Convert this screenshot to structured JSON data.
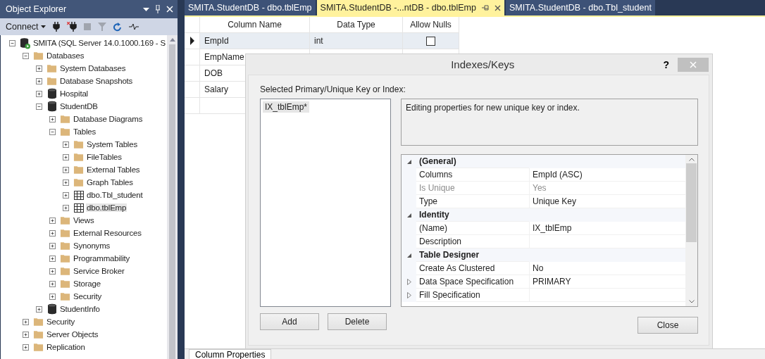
{
  "explorer": {
    "title": "Object Explorer",
    "connect": "Connect",
    "tree": [
      {
        "label": "SMITA (SQL Server 14.0.1000.169 - S",
        "kind": "server",
        "expanded": true,
        "selected": false,
        "children": [
          {
            "label": "Databases",
            "kind": "folder",
            "expanded": true,
            "selected": false,
            "children": [
              {
                "label": "System Databases",
                "kind": "folder",
                "expanded": false,
                "selected": false
              },
              {
                "label": "Database Snapshots",
                "kind": "folder",
                "expanded": false,
                "selected": false
              },
              {
                "label": "Hospital",
                "kind": "database",
                "expanded": false,
                "selected": false
              },
              {
                "label": "StudentDB",
                "kind": "database",
                "expanded": true,
                "selected": false,
                "children": [
                  {
                    "label": "Database Diagrams",
                    "kind": "folder",
                    "expanded": false,
                    "selected": false
                  },
                  {
                    "label": "Tables",
                    "kind": "folder",
                    "expanded": true,
                    "selected": false,
                    "children": [
                      {
                        "label": "System Tables",
                        "kind": "folder",
                        "expanded": false,
                        "selected": false
                      },
                      {
                        "label": "FileTables",
                        "kind": "folder",
                        "expanded": false,
                        "selected": false
                      },
                      {
                        "label": "External Tables",
                        "kind": "folder",
                        "expanded": false,
                        "selected": false
                      },
                      {
                        "label": "Graph Tables",
                        "kind": "folder",
                        "expanded": false,
                        "selected": false
                      },
                      {
                        "label": "dbo.Tbl_student",
                        "kind": "table",
                        "expanded": false,
                        "selected": false
                      },
                      {
                        "label": "dbo.tblEmp",
                        "kind": "table",
                        "expanded": false,
                        "selected": true
                      }
                    ]
                  },
                  {
                    "label": "Views",
                    "kind": "folder",
                    "expanded": false,
                    "selected": false
                  },
                  {
                    "label": "External Resources",
                    "kind": "folder",
                    "expanded": false,
                    "selected": false
                  },
                  {
                    "label": "Synonyms",
                    "kind": "folder",
                    "expanded": false,
                    "selected": false
                  },
                  {
                    "label": "Programmability",
                    "kind": "folder",
                    "expanded": false,
                    "selected": false
                  },
                  {
                    "label": "Service Broker",
                    "kind": "folder",
                    "expanded": false,
                    "selected": false
                  },
                  {
                    "label": "Storage",
                    "kind": "folder",
                    "expanded": false,
                    "selected": false
                  },
                  {
                    "label": "Security",
                    "kind": "folder",
                    "expanded": false,
                    "selected": false
                  }
                ]
              },
              {
                "label": "StudentInfo",
                "kind": "database",
                "expanded": false,
                "selected": false
              }
            ]
          },
          {
            "label": "Security",
            "kind": "folder",
            "expanded": false,
            "selected": false
          },
          {
            "label": "Server Objects",
            "kind": "folder",
            "expanded": false,
            "selected": false
          },
          {
            "label": "Replication",
            "kind": "folder",
            "expanded": false,
            "selected": false
          }
        ]
      }
    ]
  },
  "tabs": [
    {
      "label": "SMITA.StudentDB - dbo.tblEmp",
      "selected": false
    },
    {
      "label": "SMITA.StudentDB -...ntDB - dbo.tblEmp",
      "selected": true
    },
    {
      "label": "SMITA.StudentDB - dbo.Tbl_student",
      "selected": false
    }
  ],
  "grid": {
    "columns": [
      "Column Name",
      "Data Type",
      "Allow Nulls"
    ],
    "rows": [
      {
        "name": "EmpId",
        "type": "int",
        "allow_nulls": false,
        "selected": true
      },
      {
        "name": "EmpName",
        "selected": false
      },
      {
        "name": "DOB",
        "selected": false
      },
      {
        "name": "Salary",
        "selected": false
      }
    ]
  },
  "dialog": {
    "title": "Indexes/Keys",
    "help": "?",
    "list_label": "Selected Primary/Unique Key or Index:",
    "items": [
      {
        "label": "IX_tblEmp*",
        "selected": true
      }
    ],
    "description": "Editing properties for new unique key or index.",
    "sections": [
      {
        "title": "(General)",
        "expanded": true,
        "rows": [
          {
            "name": "Columns",
            "value": "EmpId (ASC)",
            "disabled": false
          },
          {
            "name": "Is Unique",
            "value": "Yes",
            "disabled": true
          },
          {
            "name": "Type",
            "value": "Unique Key",
            "disabled": false
          }
        ]
      },
      {
        "title": "Identity",
        "expanded": true,
        "rows": [
          {
            "name": "(Name)",
            "value": "IX_tblEmp",
            "disabled": false
          },
          {
            "name": "Description",
            "disabled": false
          }
        ]
      },
      {
        "title": "Table Designer",
        "expanded": true,
        "rows": [
          {
            "name": "Create As Clustered",
            "value": "No",
            "disabled": false
          },
          {
            "name": "Data Space Specification",
            "value": "PRIMARY",
            "disabled": false,
            "expandable": true
          },
          {
            "name": "Fill Specification",
            "disabled": false,
            "expandable": true
          }
        ]
      }
    ],
    "buttons": [
      "Add",
      "Delete"
    ],
    "close": "Close"
  },
  "bottom_tab": "Column Properties"
}
